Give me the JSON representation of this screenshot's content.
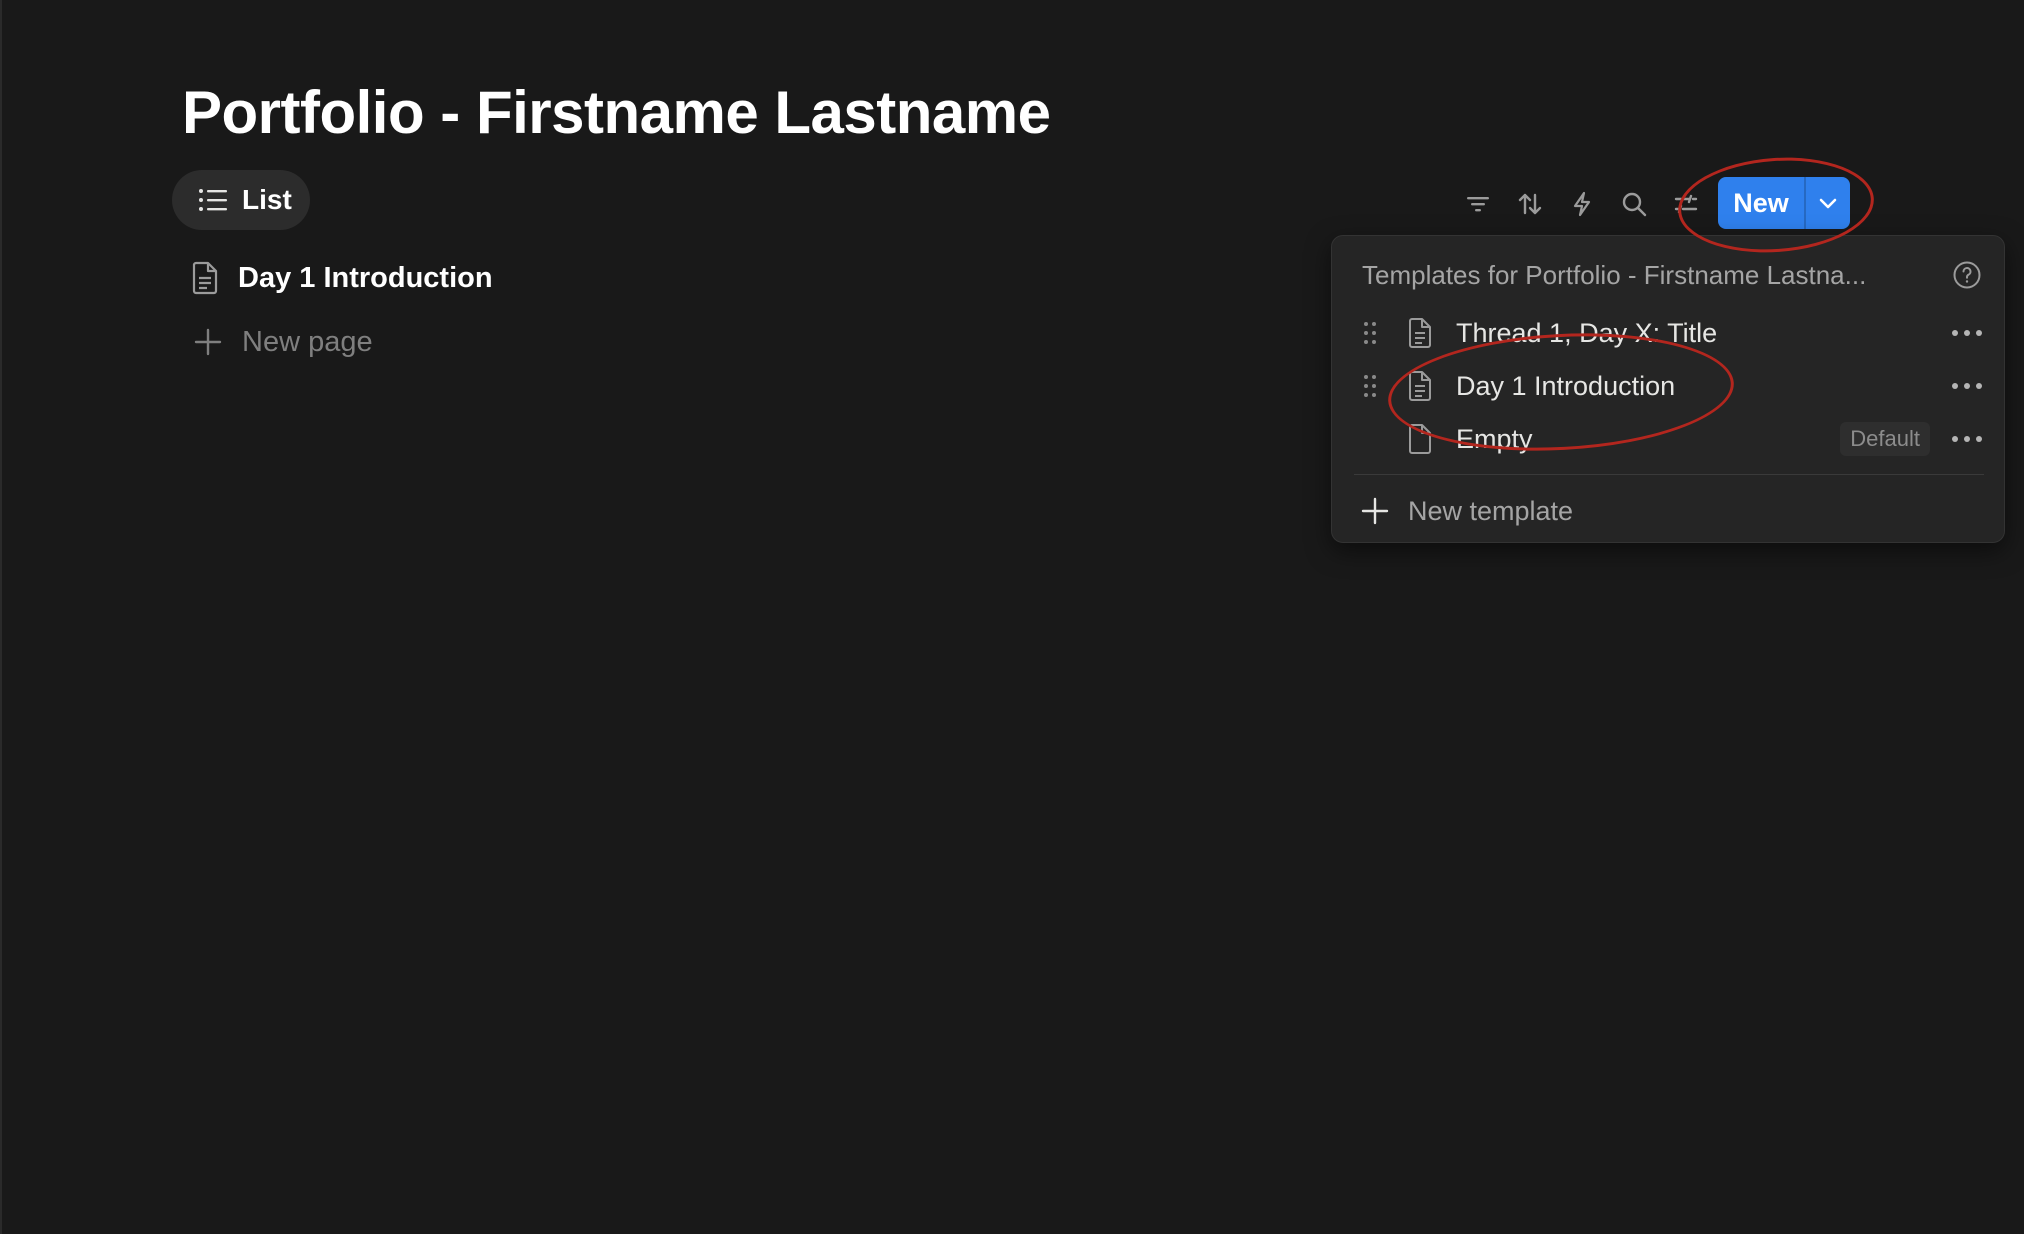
{
  "page": {
    "title": "Portfolio - Firstname Lastname"
  },
  "view_tabs": [
    {
      "label": "List",
      "icon": "list-icon"
    }
  ],
  "toolbar": {
    "icons": [
      "filter-icon",
      "sort-icon",
      "automation-bolt-icon",
      "search-icon",
      "settings-sliders-icon"
    ],
    "new_label": "New",
    "new_caret_icon": "chevron-down-icon",
    "accent": "#2f80ed"
  },
  "list": {
    "items": [
      {
        "label": "Day 1 Introduction",
        "icon": "page-icon"
      }
    ],
    "new_page_label": "New page"
  },
  "templates_menu": {
    "header": "Templates for Portfolio - Firstname Lastna...",
    "help_icon": "help-circle-icon",
    "items": [
      {
        "label": "Thread 1, Day X: Title",
        "icon": "page-text-icon",
        "badge": ""
      },
      {
        "label": "Day 1 Introduction",
        "icon": "page-text-icon",
        "badge": ""
      },
      {
        "label": "Empty",
        "icon": "page-icon",
        "badge": "Default"
      }
    ],
    "new_template_label": "New template"
  },
  "annotations": {
    "color": "#b3261e"
  }
}
